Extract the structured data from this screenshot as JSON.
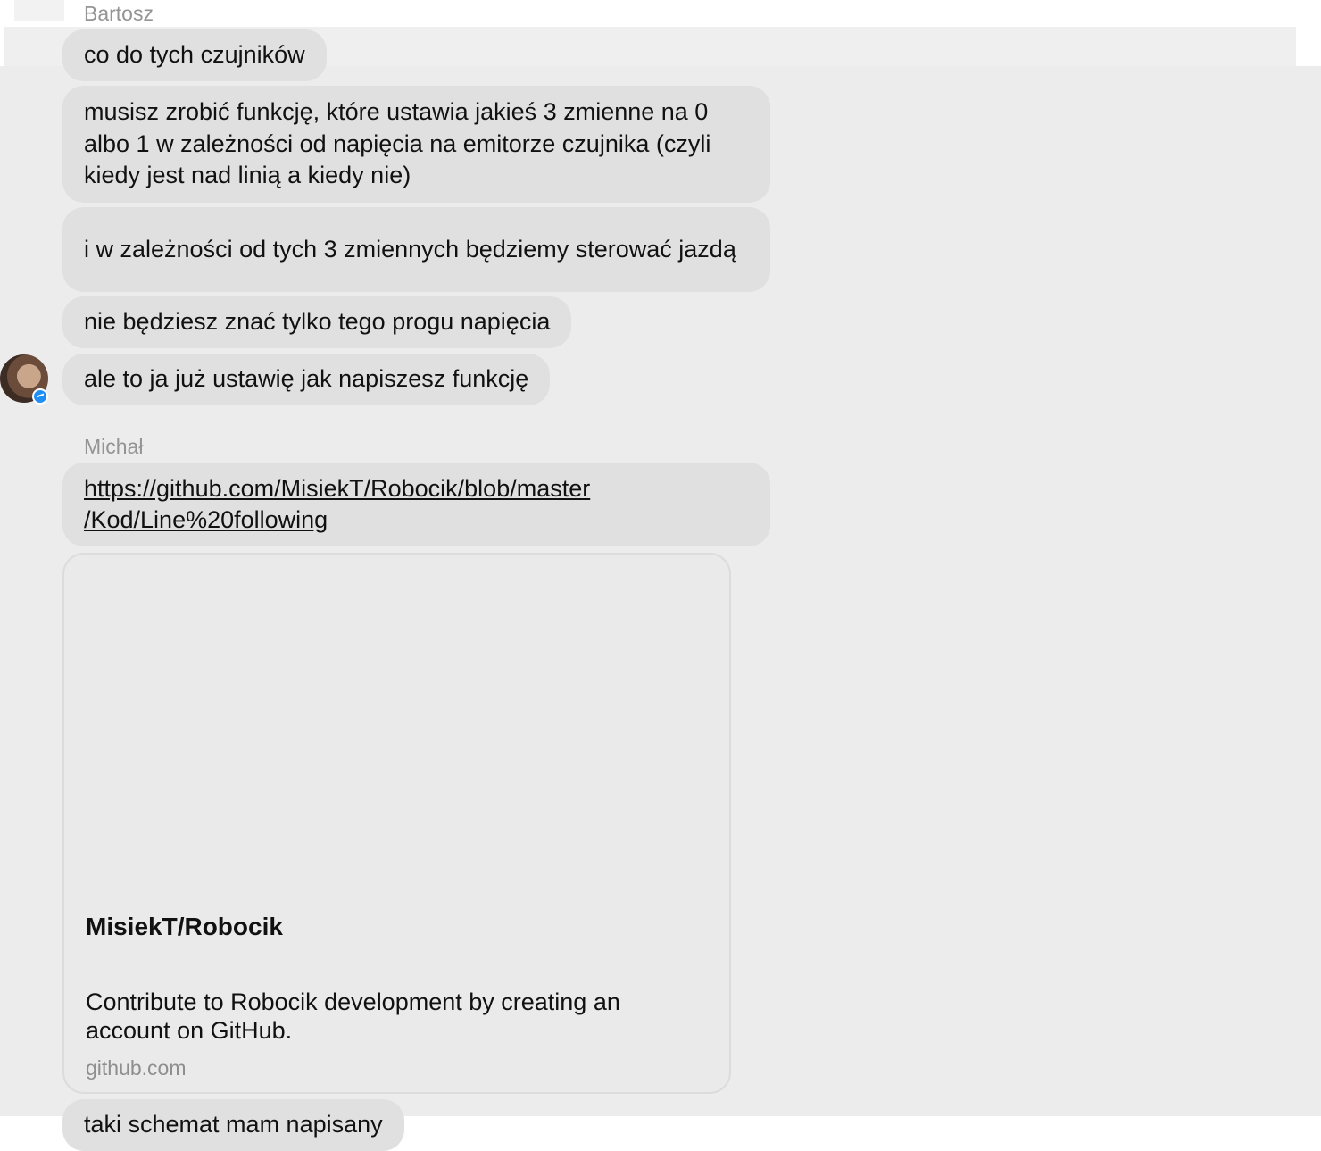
{
  "conversation": {
    "groups": [
      {
        "sender": "Bartosz",
        "messages": [
          "co do tych czujników",
          "musisz zrobić funkcję, które ustawia jakieś 3 zmienne na 0 albo 1 w zależności od napięcia na emitorze czujnika (czyli kiedy jest nad linią a kiedy nie)",
          "i w zależności od tych 3 zmiennych będziemy sterować jazdą",
          "nie będziesz znać tylko tego progu napięcia",
          "ale to ja już ustawię jak napiszesz funkcję"
        ]
      },
      {
        "sender": "Michał",
        "link": {
          "url_line1": "https://github.com/MisiekT/Robocik/blob/master",
          "url_line2": "/Kod/Line%20following"
        },
        "preview": {
          "title": "MisiekT/Robocik",
          "description": "Contribute to Robocik development by creating an account on GitHub.",
          "domain": "github.com"
        },
        "messages": [
          "taki schemat mam napisany"
        ]
      }
    ]
  },
  "icons": {
    "avatar": "user-avatar",
    "badge": "messenger-badge-icon"
  },
  "colors": {
    "bubble": "#e0e0e0",
    "sender_label": "#949494",
    "badge": "#1f8ff5"
  }
}
